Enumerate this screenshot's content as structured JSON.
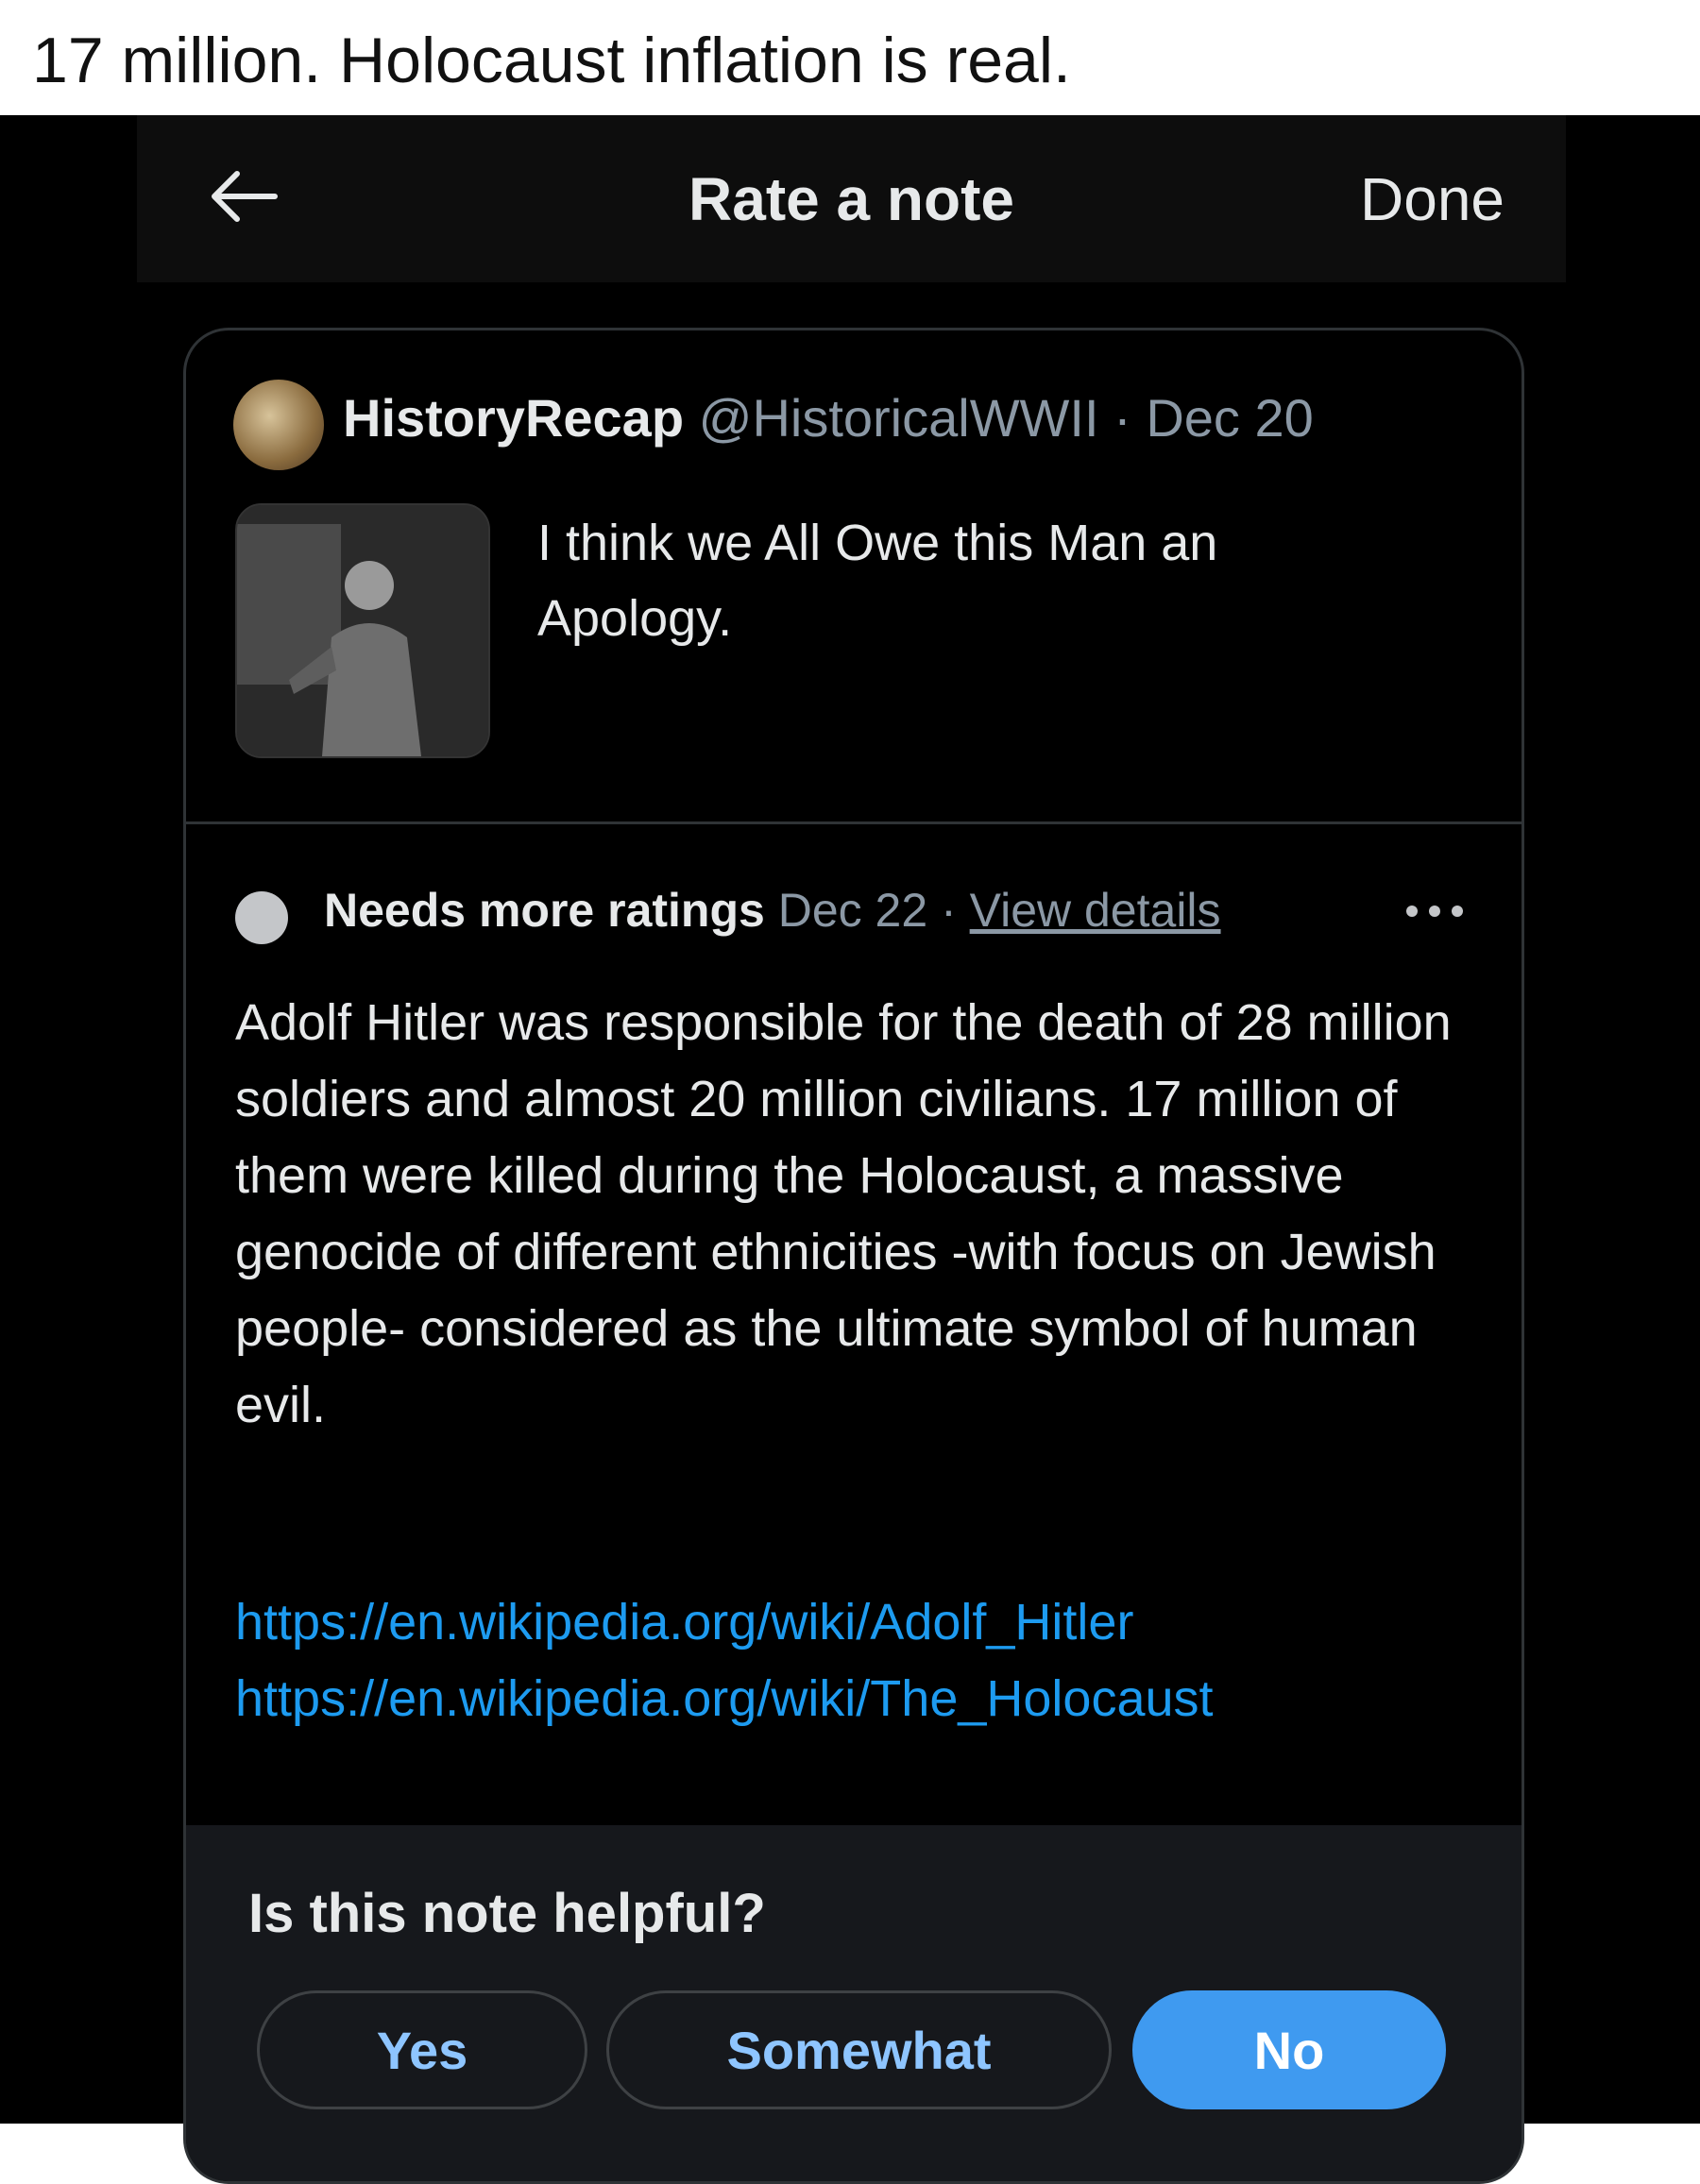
{
  "caption": "17 million. Holocaust inflation is real.",
  "topbar": {
    "back_icon": "arrow-left-icon",
    "title": "Rate a note",
    "done_label": "Done"
  },
  "tweet": {
    "author_name": "HistoryRecap",
    "handle": "@HistoricalWWII",
    "separator": "·",
    "date": "Dec 20",
    "text": "I think we All Owe this Man an Apology."
  },
  "note": {
    "status": "Needs more ratings",
    "date": "Dec 22",
    "separator": "·",
    "view_details": "View details",
    "more_icon": "more-horizontal-icon",
    "text": "Adolf Hitler was responsible for the death of 28 million soldiers and almost 20 million civilians. 17 million of them were killed during the Holocaust, a massive genocide of different ethnicities -with focus on Jewish people- considered as the ultimate symbol of human evil.",
    "links": [
      "https://en.wikipedia.org/wiki/Adolf_Hitler",
      "https://en.wikipedia.org/wiki/The_Holocaust"
    ]
  },
  "rating": {
    "question": "Is this note helpful?",
    "options": [
      "Yes",
      "Somewhat",
      "No"
    ],
    "selected": "No"
  },
  "colors": {
    "background": "#000000",
    "accent": "#1d9bf0",
    "selected_button": "#3f9af0",
    "muted_text": "#8b98a5"
  }
}
